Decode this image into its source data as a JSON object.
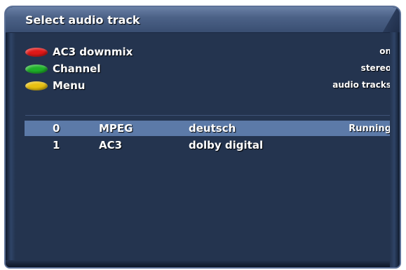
{
  "title": "Select audio track",
  "keys": [
    {
      "color": "#e01818",
      "label": "AC3 downmix",
      "value": "on"
    },
    {
      "color": "#1fb22a",
      "label": "Channel",
      "value": "stereo"
    },
    {
      "color": "#e8c010",
      "label": "Menu",
      "value": "audio tracks"
    }
  ],
  "tracks": [
    {
      "num": "0",
      "type": "MPEG",
      "lang": "deutsch",
      "status": "Running"
    },
    {
      "num": "1",
      "type": "AC3",
      "lang": "dolby digital",
      "status": ""
    }
  ],
  "colors": {
    "background": "#24344f",
    "title_bar": "#4c6287",
    "selection": "#5c7aa8"
  }
}
